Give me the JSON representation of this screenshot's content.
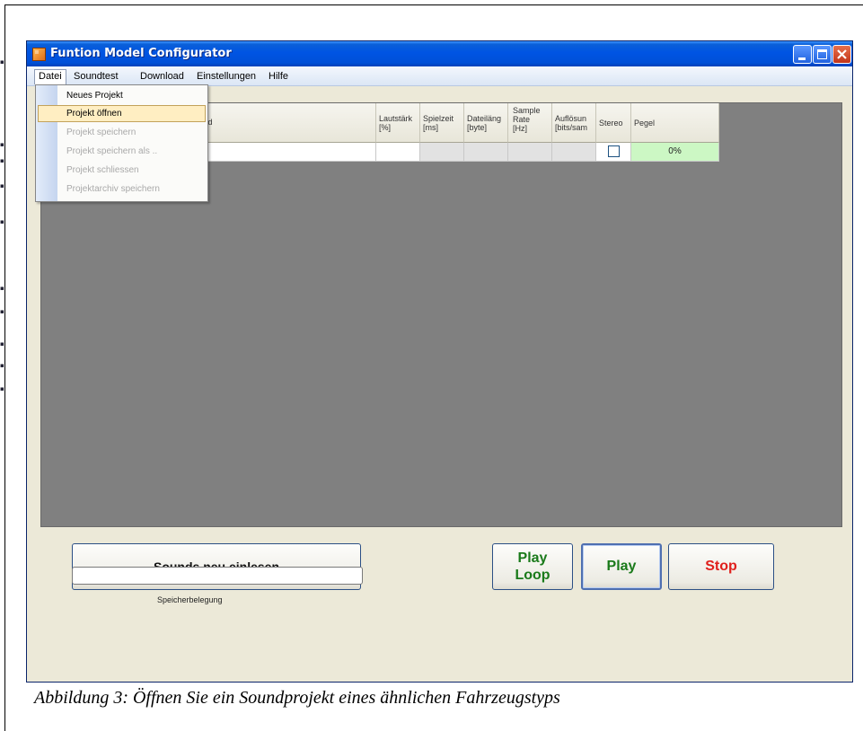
{
  "window": {
    "title": "Funtion Model Configurator"
  },
  "menubar": {
    "items": [
      {
        "label": "Datei"
      },
      {
        "label": "Soundtest"
      },
      {
        "label": "Download"
      },
      {
        "label": "Einstellungen"
      },
      {
        "label": "Hilfe"
      }
    ]
  },
  "datei_menu": {
    "items": [
      {
        "label": "Neues Projekt",
        "enabled": true
      },
      {
        "label": "Projekt öffnen",
        "enabled": true,
        "highlighted": true
      },
      {
        "label": "Projekt speichern",
        "enabled": false
      },
      {
        "label": "Projekt speichern als ..",
        "enabled": false
      },
      {
        "label": "Projekt schliessen",
        "enabled": false
      },
      {
        "label": "Projektarchiv speichern",
        "enabled": false
      }
    ]
  },
  "grid": {
    "columns": {
      "pfad": "fad",
      "lautstaerke": "Lautstärk\n[%]",
      "spielzeit": "Spielzeit\n[ms]",
      "dateilaenge": "Dateiläng\n[byte]",
      "samplerate": "Sample\nRate\n[Hz]",
      "aufloesung": "Auflösun\n[bits/sam",
      "stereo": "Stereo",
      "pegel": "Pegel"
    },
    "row": {
      "pegel_value": "0%",
      "stereo_checked": false
    }
  },
  "buttons": {
    "reload": "Sounds neu einlesen",
    "play_loop_line1": "Play",
    "play_loop_line2": "Loop",
    "play": "Play",
    "stop": "Stop"
  },
  "memory": {
    "label": "Speicherbelegung",
    "usage_fraction": 0
  },
  "caption": "Abbildung 3: Öffnen Sie ein Soundprojekt eines ähnlichen Fahrzeugstyps",
  "colors": {
    "play_text": "#1a7a1a",
    "stop_text": "#e0201c",
    "pegel_bg": "#ccf7c4",
    "menu_hover": "#ffeec2",
    "title_bar": "#0054e3"
  },
  "icons": [
    "app-icon",
    "minimize-icon",
    "maximize-icon",
    "close-icon"
  ]
}
